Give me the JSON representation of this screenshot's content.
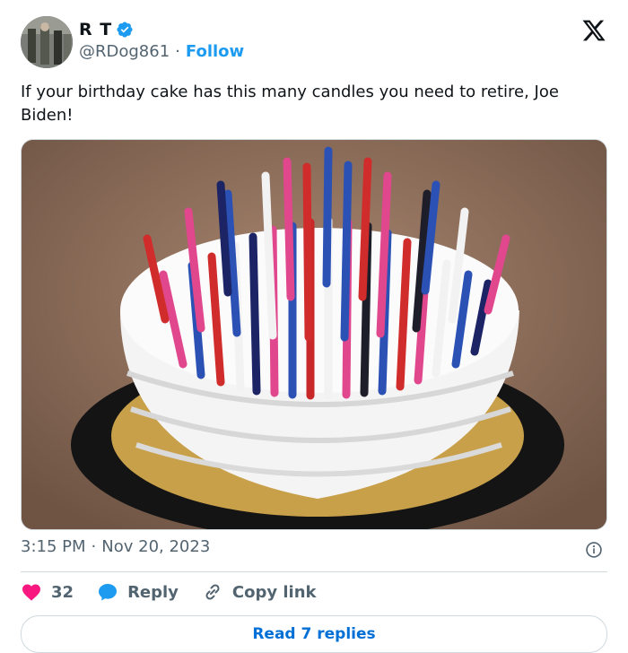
{
  "author": {
    "display_name": "R T",
    "handle": "@RDog861",
    "separator": "·",
    "follow_label": "Follow"
  },
  "tweet": {
    "text": "If your birthday cake has this many candles you need to retire, Joe Biden!",
    "time": "3:15 PM",
    "separator": "·",
    "date": "Nov 20, 2023"
  },
  "actions": {
    "like_count": "32",
    "reply_label": "Reply",
    "copy_label": "Copy link"
  },
  "read_replies_label": "Read 7 replies",
  "colors": {
    "accent": "#1d9bf0",
    "like": "#f91880",
    "muted": "#536471",
    "text": "#0f1419"
  },
  "icons": [
    "verified-badge-icon",
    "x-logo-icon",
    "info-icon",
    "heart-icon",
    "reply-bubble-icon",
    "link-icon"
  ]
}
